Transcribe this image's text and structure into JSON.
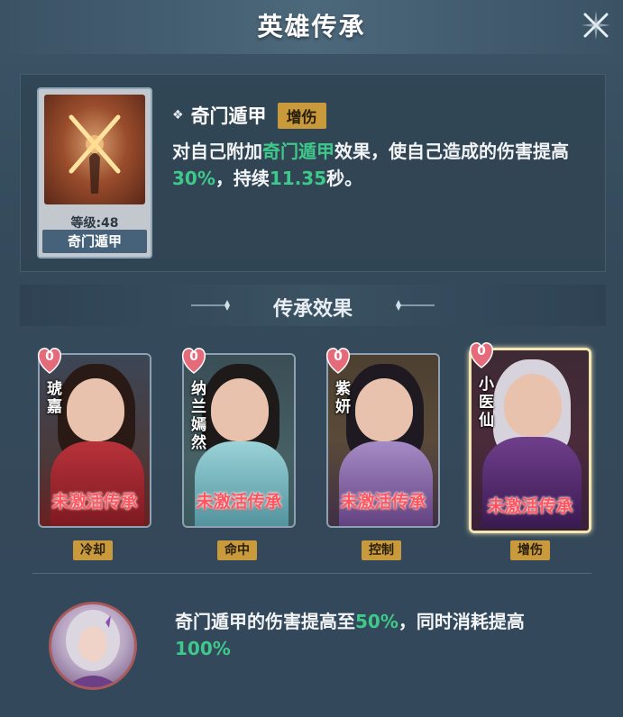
{
  "header": {
    "title": "英雄传承"
  },
  "skill": {
    "card_level": "等级:48",
    "card_name": "奇门遁甲",
    "name": "奇门遁甲",
    "tag": "增伤",
    "desc": {
      "p1": "对自己附加",
      "h1": "奇门遁甲",
      "p2": "效果，使自己造成的伤害提高",
      "h2": "30%",
      "p3": "，持续",
      "h3": "11.35",
      "p4": "秒。"
    }
  },
  "section": {
    "title": "传承效果"
  },
  "heroes": [
    {
      "name": "琥嘉",
      "count": "0",
      "status": "未激活传承",
      "tag": "冷却"
    },
    {
      "name": "纳兰嫣然",
      "count": "0",
      "status": "未激活传承",
      "tag": "命中"
    },
    {
      "name": "紫妍",
      "count": "0",
      "status": "未激活传承",
      "tag": "控制"
    },
    {
      "name": "小医仙",
      "count": "0",
      "status": "未激活传承",
      "tag": "增伤"
    }
  ],
  "bonus": {
    "p1": "奇门遁甲的伤害提高至",
    "h1": "50%",
    "p2": "，同时消耗提高",
    "h2": "100%"
  },
  "colors": {
    "highlight": "#3ec98a",
    "tag_gold": "#c89a3c",
    "status_red": "#ff5560"
  }
}
